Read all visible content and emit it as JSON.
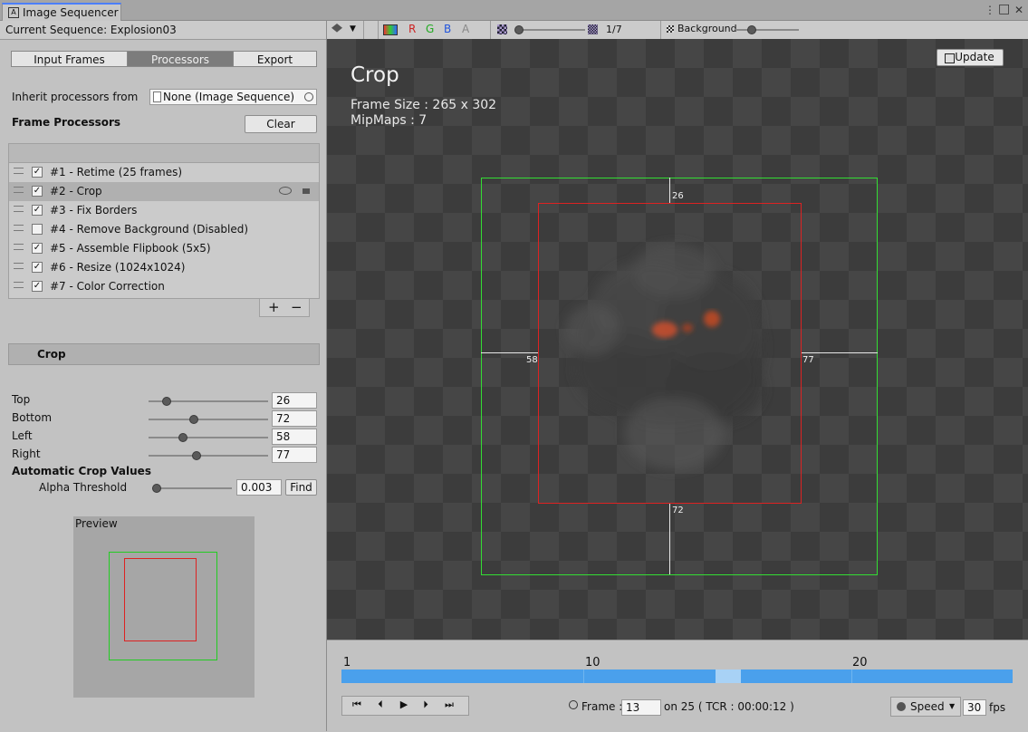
{
  "window": {
    "tab_title": "Image Sequencer",
    "menu_glyph": "⋮",
    "maximize_glyph": "□",
    "close_glyph": "✕"
  },
  "left": {
    "current_sequence": "Current Sequence: Explosion03",
    "tabs": [
      "Input Frames",
      "Processors",
      "Export"
    ],
    "inherit_label": "Inherit processors from",
    "inherit_value": "None (Image Sequence)",
    "frame_processors_label": "Frame Processors",
    "clear_label": "Clear",
    "processors": [
      {
        "label": "#1 - Retime (25 frames)",
        "checked": true
      },
      {
        "label": "#2 - Crop",
        "checked": true,
        "selected": true
      },
      {
        "label": "#3 - Fix Borders",
        "checked": true
      },
      {
        "label": "#4 - Remove Background (Disabled)",
        "checked": false
      },
      {
        "label": "#5 - Assemble Flipbook (5x5)",
        "checked": true
      },
      {
        "label": "#6 - Resize (1024x1024)",
        "checked": true
      },
      {
        "label": "#7 - Color Correction",
        "checked": true
      }
    ],
    "add_glyph": "+",
    "remove_glyph": "−",
    "crop_header": "Crop",
    "params": [
      {
        "label": "Top",
        "value": "26",
        "level": 0.15
      },
      {
        "label": "Bottom",
        "value": "72",
        "level": 0.38
      },
      {
        "label": "Left",
        "value": "58",
        "level": 0.29
      },
      {
        "label": "Right",
        "value": "77",
        "level": 0.4
      }
    ],
    "auto_crop_label": "Automatic Crop Values",
    "alpha_label": "Alpha Threshold",
    "alpha_value": "0.003",
    "alpha_level": 0.0,
    "find_label": "Find",
    "preview_label": "Preview"
  },
  "toolbar": {
    "channels": [
      "R",
      "G",
      "B",
      "A"
    ],
    "channel_colors": [
      "#cc2222",
      "#22aa22",
      "#2255dd",
      "#888888"
    ],
    "mip_text": "1/7",
    "background_label": "Background",
    "update_label": "Update"
  },
  "viewport": {
    "title": "Crop",
    "frame_size": "Frame Size : 265 x 302",
    "mipmaps": "MipMaps : 7",
    "top_value": "26",
    "bottom_value": "72",
    "left_value": "58",
    "right_value": "77"
  },
  "timeline": {
    "markers": [
      "1",
      "10",
      "20"
    ],
    "frame_label": "Frame :",
    "frame_value": "13",
    "frame_info": "on 25 ( TCR : 00:00:12 )",
    "speed_label": "Speed",
    "fps_value": "30",
    "fps_label": "fps",
    "total_frames": 25,
    "current_frame": 13
  }
}
